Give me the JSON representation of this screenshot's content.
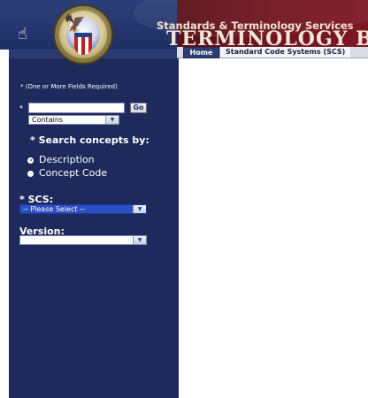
{
  "header": {
    "subtitle": "Standards & Terminology Services",
    "title": "TERMINOLOGY BROWS"
  },
  "tabs": [
    {
      "label": "Home",
      "active": true
    },
    {
      "label": "Standard Code Systems (SCS)",
      "active": false
    }
  ],
  "sidebar": {
    "required_note": "* (One or More Fields Required)",
    "search_required_mark": "*",
    "search_value": "",
    "go_label": "Go",
    "match_mode": "Contains",
    "search_by_label": "* Search concepts by:",
    "options": [
      {
        "label": "Description",
        "checked": true
      },
      {
        "label": "Concept Code",
        "checked": false
      }
    ],
    "scs_label": "* SCS:",
    "scs_selected": "-- Please Select --",
    "version_label": "Version:",
    "version_selected": ""
  },
  "colors": {
    "sidebar_bg": "#1e2a5c",
    "banner_dark": "#4a0f16",
    "active_tab": "#2c3d73",
    "select_highlight": "#2a4fc0"
  },
  "icons": {
    "cursor": "hand-pointer-icon",
    "seal": "va-seal-icon",
    "dropdown": "chevron-down-icon"
  }
}
